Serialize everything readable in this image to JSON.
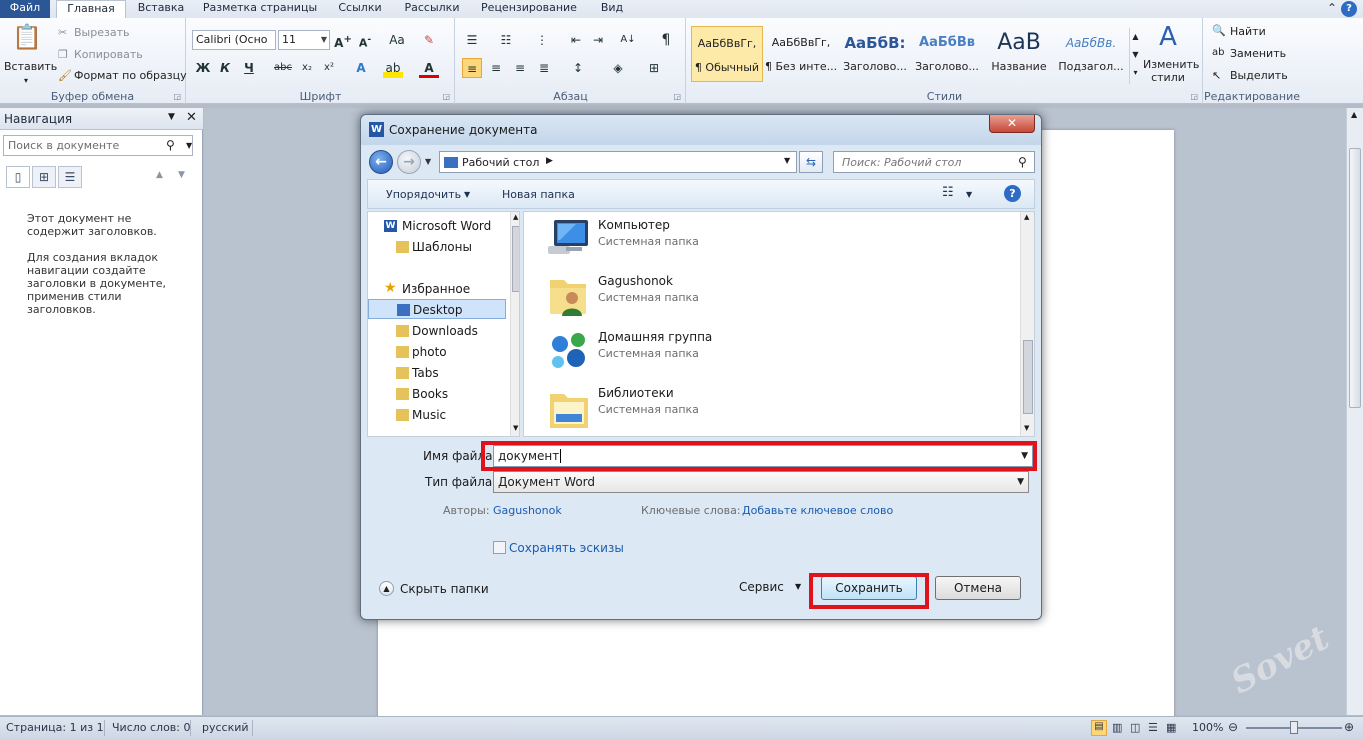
{
  "ribbon": {
    "tabs": [
      "Файл",
      "Главная",
      "Вставка",
      "Разметка страницы",
      "Ссылки",
      "Рассылки",
      "Рецензирование",
      "Вид"
    ],
    "active_tab": "Главная",
    "clipboard": {
      "paste": "Вставить",
      "cut": "Вырезать",
      "copy": "Копировать",
      "format_painter": "Формат по образцу",
      "label": "Буфер обмена"
    },
    "font": {
      "name": "Calibri (Осно",
      "size": "11",
      "label": "Шрифт",
      "bold": "Ж",
      "italic": "К",
      "underline": "Ч"
    },
    "paragraph": {
      "label": "Абзац"
    },
    "styles": {
      "label": "Стили",
      "items": [
        {
          "preview": "АаБбВвГг,",
          "name": "¶ Обычный"
        },
        {
          "preview": "АаБбВвГг,",
          "name": "¶ Без инте..."
        },
        {
          "preview": "АаБбВ:",
          "name": "Заголово..."
        },
        {
          "preview": "АаБбВв",
          "name": "Заголово..."
        },
        {
          "preview": "АаВ",
          "name": "Название"
        },
        {
          "preview": "АаБбВв.",
          "name": "Подзагол..."
        }
      ],
      "change_styles": "Изменить стили"
    },
    "editing": {
      "find": "Найти",
      "replace": "Заменить",
      "select": "Выделить",
      "label": "Редактирование"
    }
  },
  "nav": {
    "title": "Навигация",
    "search_placeholder": "Поиск в документе",
    "message1": "Этот документ не содержит заголовков.",
    "message2": "Для создания вкладок навигации создайте заголовки в документе, применив стили заголовков."
  },
  "dialog": {
    "title": "Сохранение документа",
    "path": "Рабочий стол",
    "search_placeholder": "Поиск: Рабочий стол",
    "organize": "Упорядочить",
    "new_folder": "Новая папка",
    "tree": [
      {
        "label": "Microsoft Word"
      },
      {
        "label": "Шаблоны"
      },
      {
        "label": "Избранное"
      },
      {
        "label": "Desktop"
      },
      {
        "label": "Downloads"
      },
      {
        "label": "photo"
      },
      {
        "label": "Tabs"
      },
      {
        "label": "Books"
      },
      {
        "label": "Music"
      }
    ],
    "files": [
      {
        "name": "Компьютер",
        "type": "Системная папка"
      },
      {
        "name": "Gagushonok",
        "type": "Системная папка"
      },
      {
        "name": "Домашняя группа",
        "type": "Системная папка"
      },
      {
        "name": "Библиотеки",
        "type": "Системная папка"
      }
    ],
    "filename_label": "Имя файла:",
    "filename_value": "документ",
    "filetype_label": "Тип файла:",
    "filetype_value": "Документ Word",
    "authors_label": "Авторы:",
    "authors_value": "Gagushonok",
    "keywords_label": "Ключевые слова:",
    "keywords_value": "Добавьте ключевое слово",
    "thumbnails_label": "Сохранять эскизы",
    "hide_folders": "Скрыть папки",
    "service": "Сервис",
    "save": "Сохранить",
    "cancel": "Отмена",
    "highlight_color": "#e0121b"
  },
  "status": {
    "page": "Страница: 1 из 1",
    "words": "Число слов: 0",
    "language": "русский",
    "zoom": "100%"
  }
}
